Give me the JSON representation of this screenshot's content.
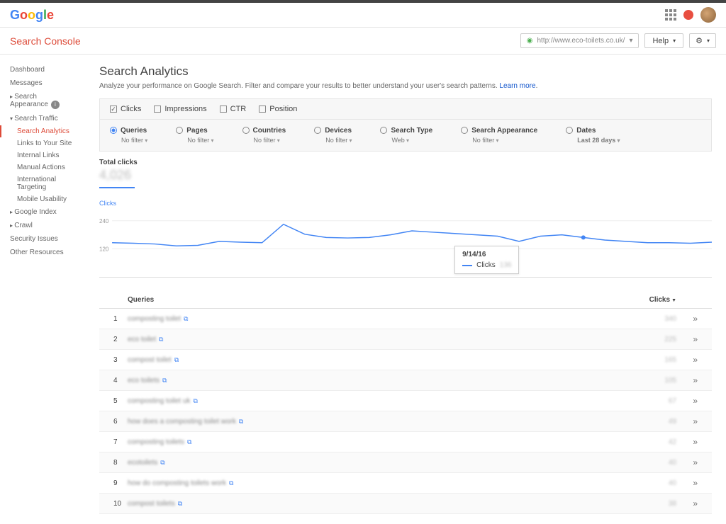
{
  "header": {
    "console_title": "Search Console",
    "url": "http://www.eco-toilets.co.uk/",
    "help": "Help"
  },
  "sidebar": {
    "dashboard": "Dashboard",
    "messages": "Messages",
    "search_appearance": "Search Appearance",
    "search_traffic": "Search Traffic",
    "traffic_items": {
      "analytics": "Search Analytics",
      "links": "Links to Your Site",
      "internal": "Internal Links",
      "manual": "Manual Actions",
      "intl": "International Targeting",
      "mobile": "Mobile Usability"
    },
    "google_index": "Google Index",
    "crawl": "Crawl",
    "security": "Security Issues",
    "other": "Other Resources"
  },
  "page": {
    "title": "Search Analytics",
    "desc": "Analyze your performance on Google Search. Filter and compare your results to better understand your user's search patterns.",
    "learn_more": "Learn more"
  },
  "metrics": {
    "clicks": "Clicks",
    "impressions": "Impressions",
    "ctr": "CTR",
    "position": "Position"
  },
  "dimensions": {
    "queries": {
      "name": "Queries",
      "filter": "No filter"
    },
    "pages": {
      "name": "Pages",
      "filter": "No filter"
    },
    "countries": {
      "name": "Countries",
      "filter": "No filter"
    },
    "devices": {
      "name": "Devices",
      "filter": "No filter"
    },
    "search_type": {
      "name": "Search Type",
      "filter": "Web"
    },
    "search_appearance": {
      "name": "Search Appearance",
      "filter": "No filter"
    },
    "dates": {
      "name": "Dates",
      "filter": "Last 28 days"
    }
  },
  "totals": {
    "label": "Total clicks",
    "value": "4,026"
  },
  "chart_data": {
    "type": "line",
    "ylabel": "Clicks",
    "ylim": [
      0,
      240
    ],
    "yticks": [
      120,
      240
    ],
    "series": [
      {
        "name": "Clicks",
        "values": [
          130,
          128,
          125,
          118,
          120,
          135,
          132,
          130,
          200,
          162,
          150,
          148,
          150,
          160,
          175,
          170,
          165,
          160,
          155,
          135,
          155,
          160,
          150,
          140,
          135,
          130,
          130,
          128,
          132
        ]
      }
    ],
    "tooltip": {
      "date": "9/14/16",
      "label": "Clicks",
      "value": "136"
    }
  },
  "table": {
    "col_queries": "Queries",
    "col_clicks": "Clicks",
    "rows": [
      {
        "idx": "1",
        "query": "composting toilet",
        "clicks": "340"
      },
      {
        "idx": "2",
        "query": "eco toilet",
        "clicks": "225"
      },
      {
        "idx": "3",
        "query": "compost toilet",
        "clicks": "165"
      },
      {
        "idx": "4",
        "query": "eco toilets",
        "clicks": "105"
      },
      {
        "idx": "5",
        "query": "composting toilet uk",
        "clicks": "67"
      },
      {
        "idx": "6",
        "query": "how does a composting toilet work",
        "clicks": "49"
      },
      {
        "idx": "7",
        "query": "composting toilets",
        "clicks": "42"
      },
      {
        "idx": "8",
        "query": "ecotoilets",
        "clicks": "40"
      },
      {
        "idx": "9",
        "query": "how do composting toilets work",
        "clicks": "40"
      },
      {
        "idx": "10",
        "query": "compost toilets",
        "clicks": "38"
      }
    ]
  }
}
